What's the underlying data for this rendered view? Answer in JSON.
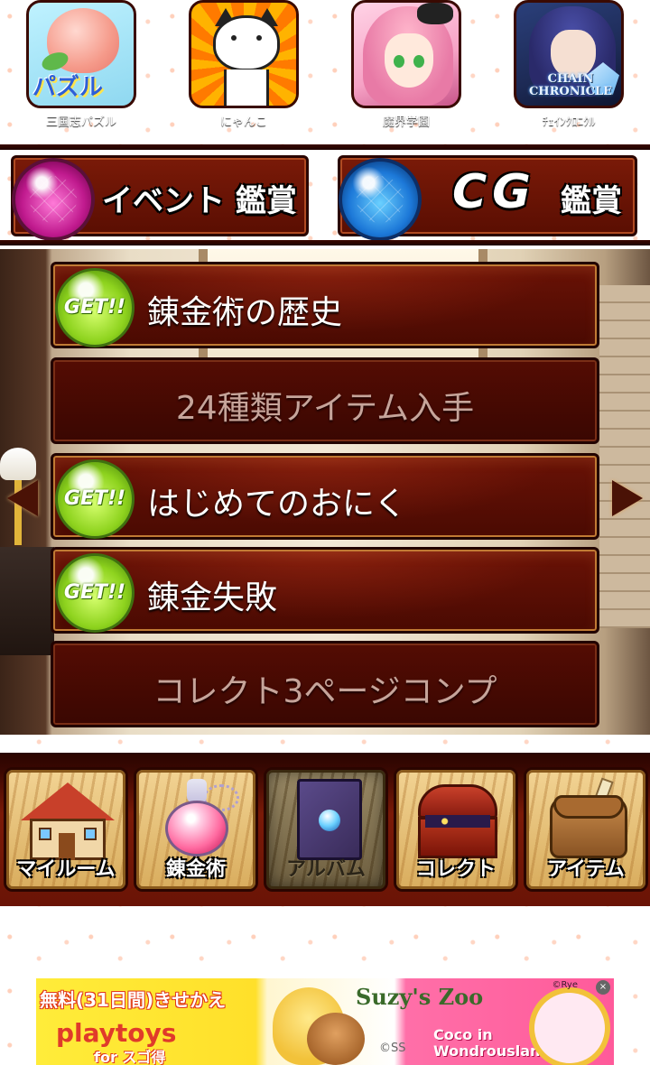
{
  "top_apps": [
    {
      "label": "三国志パズル",
      "icon": "peach-puzzle-app-icon",
      "logo": "パズル"
    },
    {
      "label": "にゃんこ",
      "icon": "white-cat-app-icon"
    },
    {
      "label": "魔界学園",
      "icon": "pink-hair-girl-app-icon"
    },
    {
      "label": "ﾁｪｲﾝｸﾛﾆｸﾙ",
      "icon": "chain-chronicle-app-icon",
      "logo": "CHAIN CHRONICLE"
    }
  ],
  "viewers": {
    "event": {
      "label": "イベント 鑑賞",
      "icon": "pink-orb-icon"
    },
    "cg": {
      "label_big": "CG",
      "label_small": "鑑賞",
      "icon": "blue-orb-icon"
    }
  },
  "achievements": [
    {
      "title": "錬金術の歴史",
      "obtained": true,
      "badge": "GET!!"
    },
    {
      "title": "24種類アイテム入手",
      "obtained": false
    },
    {
      "title": "はじめてのおにく",
      "obtained": true,
      "badge": "GET!!"
    },
    {
      "title": "錬金失敗",
      "obtained": true,
      "badge": "GET!!"
    },
    {
      "title": "コレクト3ページコンプ",
      "obtained": false
    }
  ],
  "nav_arrows": {
    "left": "previous-page-arrow",
    "right": "next-page-arrow"
  },
  "bottom_nav": [
    {
      "label": "マイルーム",
      "icon": "house-icon",
      "active": false
    },
    {
      "label": "錬金術",
      "icon": "potion-flask-icon",
      "active": false
    },
    {
      "label": "アルバム",
      "icon": "album-book-icon",
      "active": true
    },
    {
      "label": "コレクト",
      "icon": "treasure-chest-icon",
      "active": false
    },
    {
      "label": "アイテム",
      "icon": "item-bag-icon",
      "active": false
    }
  ],
  "ad": {
    "headline": "無料(31日間)きせかえ",
    "brand": "playtoys",
    "sub": "for スゴ得",
    "suzy": "Suzy's Zoo",
    "ss": "©SS",
    "coco": "Coco in Wondrousland",
    "copyright": "©Rye",
    "close": "×"
  },
  "colors": {
    "background": "#7a1a08",
    "panel_border": "#c07a34",
    "get_badge": "#8ed31e",
    "locked_text": "#c6a49a"
  }
}
